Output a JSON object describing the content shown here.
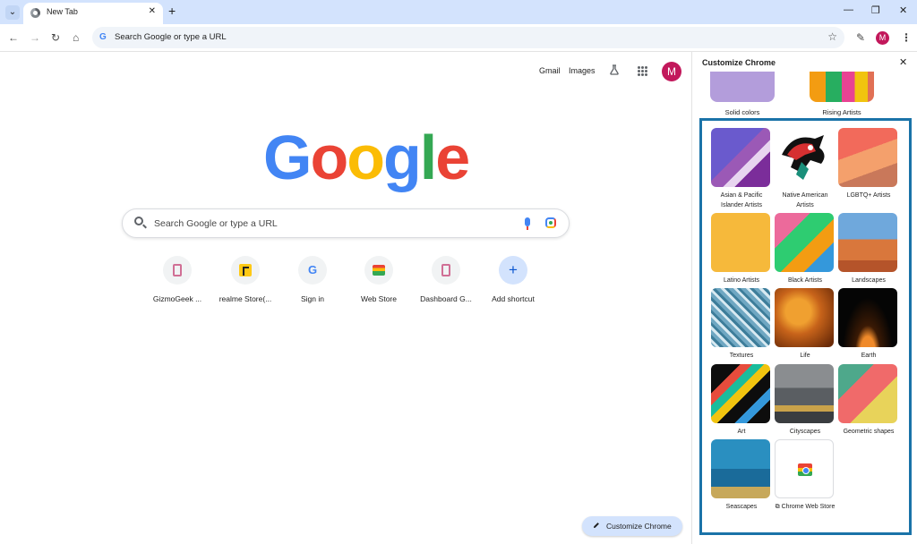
{
  "window": {
    "tab_title": "New Tab",
    "minimize": "—",
    "restore": "❐",
    "close": "✕"
  },
  "toolbar": {
    "omnibox_placeholder": "Search Google or type a URL",
    "profile_initial": "M"
  },
  "ntp": {
    "gmail": "Gmail",
    "images": "Images",
    "profile_initial": "M",
    "logo": [
      "G",
      "o",
      "o",
      "g",
      "l",
      "e"
    ],
    "search_placeholder": "Search Google or type a URL",
    "shortcuts": [
      {
        "label": "GizmoGeek ...",
        "icon": "phone-favicon-icon"
      },
      {
        "label": "realme Store(...",
        "icon": "realme-favicon-icon"
      },
      {
        "label": "Sign in",
        "icon": "google-g-icon"
      },
      {
        "label": "Web Store",
        "icon": "web-store-icon"
      },
      {
        "label": "Dashboard G...",
        "icon": "phone-favicon-icon"
      },
      {
        "label": "Add shortcut",
        "icon": "plus-icon"
      }
    ],
    "customize_button": "Customize Chrome"
  },
  "panel": {
    "title": "Customize Chrome",
    "top_labels": [
      "Solid colors",
      "Rising Artists"
    ],
    "collections": [
      "Asian & Pacific Islander Artists",
      "Native American Artists",
      "LGBTQ+ Artists",
      "Latino Artists",
      "Black Artists",
      "Landscapes",
      "Textures",
      "Life",
      "Earth",
      "Art",
      "Cityscapes",
      "Geometric shapes",
      "Seascapes",
      "Chrome Web Store"
    ],
    "accent_color": "#1a73a8"
  }
}
